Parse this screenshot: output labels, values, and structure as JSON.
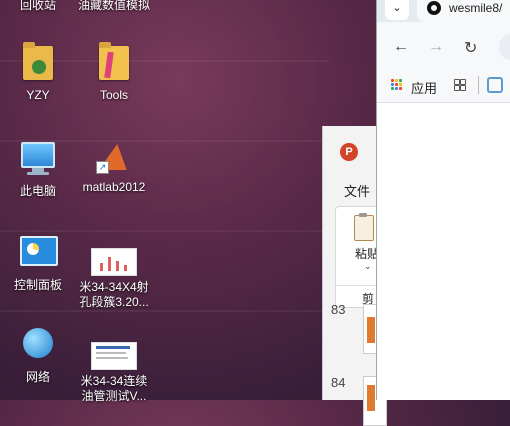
{
  "desktop": {
    "top_labels": [
      "回收站",
      "油藏数值模拟"
    ],
    "icons": [
      {
        "label": "YZY",
        "icon": "user-folder-icon"
      },
      {
        "label": "Tools",
        "icon": "tools-folder-icon"
      },
      {
        "label": "此电脑",
        "icon": "computer-icon"
      },
      {
        "label": "matlab2012",
        "icon": "matlab-icon"
      },
      {
        "label": "控制面板",
        "icon": "control-panel-icon"
      },
      {
        "label": "米34-34X4射孔段簇3.20...",
        "line1": "米34-34X4射",
        "line2": "孔段簇3.20...",
        "icon": "document-thumbnail-icon"
      },
      {
        "label": "网络",
        "icon": "network-icon"
      },
      {
        "label": "米34-34连续油管测试V...",
        "line1": "米34-34连续",
        "line2": "油管测试V...",
        "icon": "document-thumbnail-icon"
      }
    ]
  },
  "powerpoint": {
    "logo": "P",
    "menu_file": "文件",
    "paste_label": "粘贴",
    "cut_label": "剪",
    "slide_numbers": [
      "83",
      "84"
    ],
    "accent_color": "#d2442a"
  },
  "browser": {
    "tab_dropdown": "⌄",
    "tab_title": "wesmile8/",
    "back": "←",
    "forward": "→",
    "reload": "↻",
    "bookmarks_apps_label": "应用"
  }
}
